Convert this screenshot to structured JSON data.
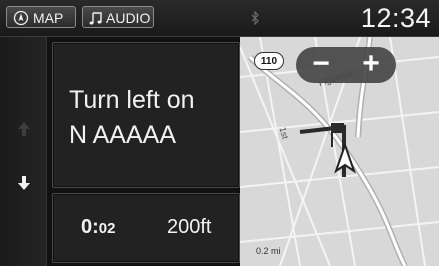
{
  "status_bar": {
    "map_label": "MAP",
    "audio_label": "AUDIO",
    "clock": "12:34",
    "icons": {
      "map": "compass-icon",
      "audio": "music-note-icon",
      "bluetooth": "bluetooth-icon"
    }
  },
  "guidance": {
    "instruction_line1": "Turn left on",
    "instruction_line2": "N AAAAA",
    "eta_prefix": "0:",
    "eta_value": "02",
    "distance": "200ft"
  },
  "map": {
    "route_shield": "110",
    "street_names": [
      "Figueroa",
      "1st"
    ],
    "scale": "0.2 mi",
    "zoom_out": "−",
    "zoom_in": "+"
  },
  "rail": {
    "icons": {
      "up": "arrow-up-icon",
      "down": "arrow-down-icon"
    }
  }
}
